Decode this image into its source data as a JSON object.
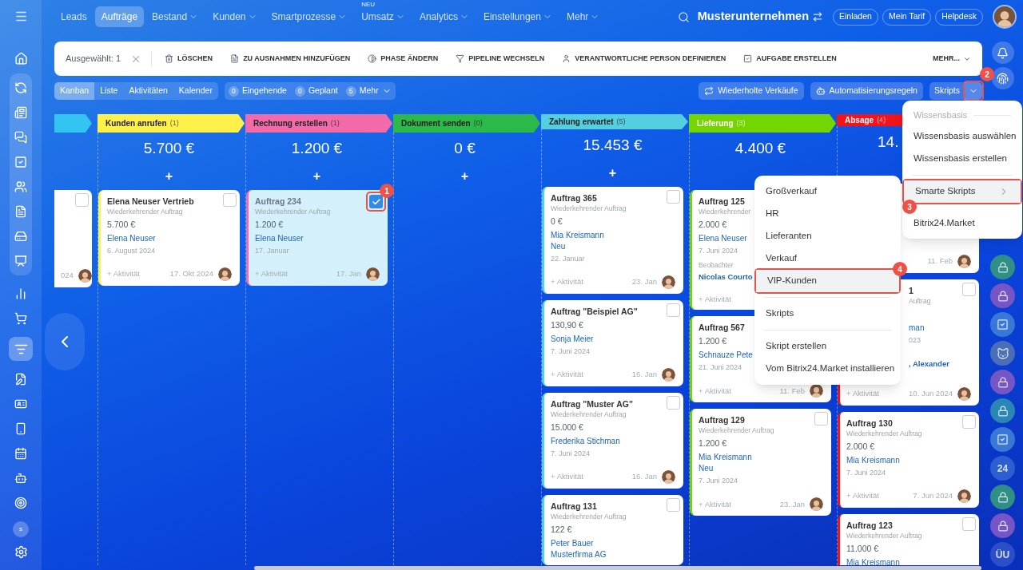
{
  "nav": {
    "items": [
      {
        "label": "Leads",
        "caret": false,
        "selected": false
      },
      {
        "label": "Aufträge",
        "caret": false,
        "selected": true
      },
      {
        "label": "Bestand",
        "caret": true,
        "selected": false
      },
      {
        "label": "Kunden",
        "caret": true,
        "selected": false
      },
      {
        "label": "Smartprozesse",
        "caret": true,
        "selected": false
      },
      {
        "label": "Umsatz",
        "caret": true,
        "selected": false,
        "tag": "NEU"
      },
      {
        "label": "Analytics",
        "caret": true,
        "selected": false
      },
      {
        "label": "Einstellungen",
        "caret": true,
        "selected": false
      },
      {
        "label": "Mehr",
        "caret": true,
        "selected": false
      }
    ],
    "company": "Musterunternehmen",
    "buttons": [
      "Einladen",
      "Mein Tarif",
      "Helpdesk"
    ]
  },
  "sidebar": {
    "user_initial": "s"
  },
  "action_bar": {
    "selected_label": "Ausgewählt: 1",
    "actions": [
      "LÖSCHEN",
      "ZU AUSNAHMEN HINZUFÜGEN",
      "PHASE ÄNDERN",
      "PIPELINE WECHSELN",
      "VERANTWORTLICHE PERSON DEFINIEREN",
      "AUFGABE ERSTELLEN"
    ],
    "more": "MEHR..."
  },
  "views": [
    {
      "label": "Kanban",
      "selected": true
    },
    {
      "label": "Liste",
      "selected": false
    },
    {
      "label": "Aktivitäten",
      "selected": false
    },
    {
      "label": "Kalender",
      "selected": false
    }
  ],
  "counters": [
    {
      "count": "0",
      "label": "Eingehende",
      "caret": false
    },
    {
      "count": "0",
      "label": "Geplant",
      "caret": false
    },
    {
      "count": "5",
      "label": "Mehr",
      "caret": true
    }
  ],
  "toolbar_right": {
    "repeat": "Wiederholte Verkäufe",
    "automation": "Automatisierungsregeln",
    "scripts": "Skripts",
    "toggle_marker": "2"
  },
  "columns": [
    {
      "kind": "clipped",
      "color": "#33c4f2",
      "cards": [
        {
          "kind": "clipped",
          "checked": false,
          "footer_date": "024"
        }
      ]
    },
    {
      "kind": "stage",
      "title": "Kunden anrufen",
      "count": "(1)",
      "color": "#fff04a",
      "light_text": false,
      "total": "5.700 €",
      "add": "+",
      "cards": [
        {
          "kind": "normal",
          "title": "Elena Neuser Vertrieb",
          "subtitle": "Wiederkehrender Auftrag",
          "amount": "5.700 €",
          "links": [
            "Elena Neuser"
          ],
          "date": "6. August 2024",
          "action": "+ Aktivität",
          "footer_date": "17. Okt 2024",
          "checked": false
        }
      ]
    },
    {
      "kind": "stage",
      "title": "Rechnung erstellen",
      "count": "(1)",
      "color": "#f26aa8",
      "light_text": false,
      "total": "1.200 €",
      "add": "+",
      "cards": [
        {
          "kind": "normal",
          "title": "Auftrag 234",
          "subtitle": "Wiederkehrender Auftrag",
          "amount": "1.200 €",
          "links": [
            "Elena Neuser"
          ],
          "date": "17. Januar",
          "action": "+ Aktivität",
          "footer_date": "17. Jan",
          "checked": true,
          "marker": "1"
        }
      ]
    },
    {
      "kind": "stage",
      "title": "Dokument senden",
      "count": "(0)",
      "color": "#2db84a",
      "light_text": false,
      "total": "0 €",
      "add": "+"
    },
    {
      "kind": "stage",
      "title": "Zahlung erwartet",
      "count": "(5)",
      "color": "#55cfe0",
      "light_text": false,
      "total": "15.453 €",
      "add": "+",
      "cards": [
        {
          "kind": "normal",
          "title": "Auftrag 365",
          "subtitle": "Wiederkehrender Auftrag",
          "amount": "0 €",
          "links": [
            "Mia Kreismann",
            "Neu"
          ],
          "date": "22. Januar",
          "action": "+ Aktivität",
          "footer_date": "23. Jan",
          "checked": false
        },
        {
          "kind": "normal",
          "title": "Auftrag \"Beispiel AG\"",
          "amount": "130,90 €",
          "links": [
            "Sonja Meier"
          ],
          "date": "7. Juni 2024",
          "action": "+ Aktivität",
          "footer_date": "16. Jan",
          "checked": false
        },
        {
          "kind": "normal",
          "title": "Auftrag \"Muster AG\"",
          "subtitle": "Wiederkehrender Auftrag",
          "amount": "15.000 €",
          "links": [
            "Frederika Stichman"
          ],
          "date": "7. Juni 2024",
          "action": "+ Aktivität",
          "footer_date": "16. Jan",
          "checked": false
        },
        {
          "kind": "normal",
          "title": "Auftrag 131",
          "subtitle": "Wiederkehrender Auftrag",
          "amount": "122 €",
          "links": [
            "Peter Bauer",
            "Musterfirma AG"
          ],
          "checked": false
        }
      ]
    },
    {
      "kind": "stage",
      "title": "Lieferung",
      "count": "(3)",
      "color": "#74d600",
      "light_text": true,
      "total": "4.400 €",
      "cards": [
        {
          "kind": "normal",
          "title": "Auftrag 125",
          "subtitle": "Wiederkehrender",
          "amount": "2.000 €",
          "links": [
            "Elena Neuser"
          ],
          "date": "7. Juni 2024",
          "observer_label": "Beobachter",
          "observer": "Nicolas Courto",
          "action": "+ Aktivität"
        },
        {
          "kind": "normal",
          "title": "Auftrag 567",
          "amount": "1.200 €",
          "links": [
            "Schnauze Pete"
          ],
          "date": "21. Juni 2024",
          "action": "+ Aktivität",
          "footer_date": "11. Feb"
        },
        {
          "kind": "normal",
          "title": "Auftrag 129",
          "subtitle": "Wiederkehrender Auftrag",
          "amount": "1.200 €",
          "links": [
            "Mia Kreismann",
            "Neu"
          ],
          "date": "7. Juni 2024",
          "action": "+ Aktivität",
          "footer_date": "23. Jan",
          "checked": false
        }
      ]
    },
    {
      "kind": "covered",
      "title": "Absage",
      "count": "(4)",
      "color": "#f0141b",
      "light_text": true,
      "total": "14.",
      "cards": [
        {
          "kind": "covered",
          "footer_date": "11. Feb"
        },
        {
          "kind": "covered",
          "title": "1",
          "subtitle": "Auftrag",
          "links": [
            "man"
          ],
          "date": "023",
          "observer": ", Alexander",
          "action": "+ Aktivität",
          "footer_date": "10. Jun 2024",
          "checked": false
        },
        {
          "kind": "normal",
          "title": "Auftrag 130",
          "subtitle": "Wiederkehrender Auftrag",
          "amount": "2.000 €",
          "links": [
            "Mia Kreismann"
          ],
          "date": "7. Juni 2024",
          "action": "+ Aktivität",
          "footer_date": "7. Jun 2024",
          "checked": false
        },
        {
          "kind": "normal",
          "title": "Auftrag 123",
          "subtitle": "Wiederkehrender Auftrag",
          "amount": "11.000 €",
          "links": [
            "Mia Kreismann"
          ],
          "checked": false
        }
      ]
    }
  ],
  "right_rail": [
    {
      "kind": "lock",
      "color": "#2f8f86"
    },
    {
      "kind": "lock",
      "color": "#7655c6"
    },
    {
      "kind": "check",
      "color": "#3a78d8"
    },
    {
      "kind": "avatar",
      "color": "#4a6fb8"
    },
    {
      "kind": "lock",
      "color": "#7655c6"
    },
    {
      "kind": "lock",
      "color": "#2a86b4"
    },
    {
      "kind": "check",
      "color": "#3a78d8"
    },
    {
      "kind": "text",
      "color": "#2e5fd0",
      "text": "24"
    },
    {
      "kind": "lock",
      "color": "#2f8f86"
    },
    {
      "kind": "lock",
      "color": "#7655c6"
    },
    {
      "kind": "text",
      "color": "#2b4fc8",
      "text": "ÜU"
    }
  ],
  "scripts_menu": [
    {
      "kind": "header",
      "label": "Wissensbasis"
    },
    {
      "kind": "item",
      "label": "Wissensbasis auswählen",
      "selected": false
    },
    {
      "kind": "item",
      "label": "Wissensbasis erstellen",
      "selected": false
    },
    {
      "kind": "divider"
    },
    {
      "kind": "item",
      "label": "Smarte Skripts",
      "selected": true,
      "submenu": true,
      "marker": "3"
    },
    {
      "kind": "item",
      "label": "Bitrix24.Market",
      "selected": false
    }
  ],
  "sub_menu": [
    {
      "kind": "item",
      "label": "Großverkauf",
      "selected": false
    },
    {
      "kind": "item",
      "label": "HR",
      "selected": false
    },
    {
      "kind": "item",
      "label": "Lieferanten",
      "selected": false
    },
    {
      "kind": "item",
      "label": "Verkauf",
      "selected": false
    },
    {
      "kind": "item",
      "label": "VIP-Kunden",
      "selected": true,
      "marker": "4"
    },
    {
      "kind": "divider"
    },
    {
      "kind": "item",
      "label": "Skripts",
      "selected": false
    },
    {
      "kind": "divider"
    },
    {
      "kind": "item",
      "label": "Skript erstellen",
      "selected": false
    },
    {
      "kind": "item",
      "label": "Vom Bitrix24.Market installieren",
      "selected": false
    }
  ]
}
